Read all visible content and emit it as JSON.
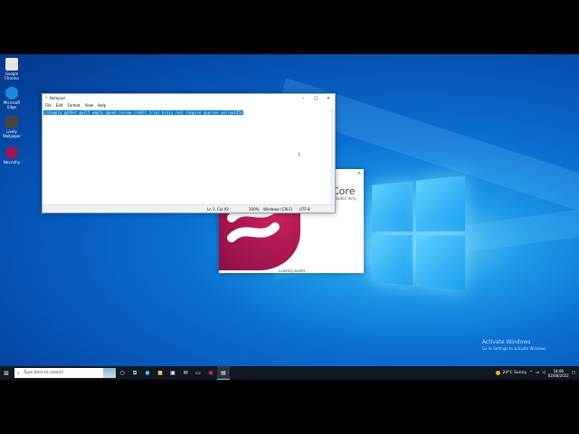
{
  "desktop": {
    "icons": [
      {
        "label": "Google Chrome",
        "icon": "chrome-icon",
        "color": "#e7e7e7"
      },
      {
        "label": "Microsoft Edge",
        "icon": "edge-icon",
        "color": "#1c8adb"
      },
      {
        "label": "Lively Wallpaper",
        "icon": "app-icon",
        "color": "#444444"
      },
      {
        "label": "Nevrathy",
        "icon": "app-icon",
        "color": "#9c1656"
      }
    ]
  },
  "notepad": {
    "title": "*- Notepad",
    "menu": [
      "File",
      "Edit",
      "Format",
      "View",
      "Help"
    ],
    "content": "category gather guilt empty speed review credit trial brain real require approve yellow1454",
    "status": {
      "position": "Ln 1, Col 92",
      "zoom": "100%",
      "line_ending": "Windows (CRLF)",
      "encoding": "UTF-8"
    }
  },
  "splash": {
    "title": "Core",
    "subtitle": "v(4)63a3b3 dirty",
    "loading": "Loading wallet..."
  },
  "activation": {
    "line1": "Activate Windows",
    "line2": "Go to Settings to activate Windows."
  },
  "taskbar": {
    "search_placeholder": "Type here to search",
    "weather": "24°C Sunny",
    "time": "18:06",
    "date": "02/08/2022"
  },
  "colors": {
    "accent": "#0078d7",
    "taskbar": "#101820",
    "core": "#9c1656"
  }
}
